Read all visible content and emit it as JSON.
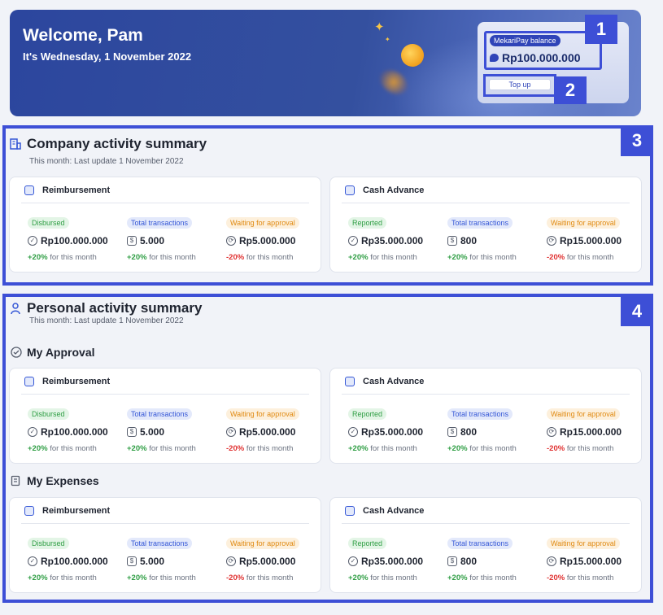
{
  "header": {
    "welcome": "Welcome, Pam",
    "date": "It's Wednesday, 1 November 2022",
    "balance_label": "MekariPay balance",
    "balance_amount": "Rp100.000.000",
    "topup_label": "Top up"
  },
  "badges": [
    "1",
    "2",
    "3",
    "4"
  ],
  "company": {
    "title": "Company activity summary",
    "subtitle": "This month: Last update 1 November 2022",
    "cards": [
      {
        "title": "Reimbursement",
        "stats": [
          {
            "label": "Disbursed",
            "value": "Rp100.000.000",
            "delta": "+20%",
            "delta_text": "for this month"
          },
          {
            "label": "Total transactions",
            "value": "5.000",
            "delta": "+20%",
            "delta_text": "for this month"
          },
          {
            "label": "Waiting for approval",
            "value": "Rp5.000.000",
            "delta": "-20%",
            "delta_text": "for this month"
          }
        ]
      },
      {
        "title": "Cash Advance",
        "stats": [
          {
            "label": "Reported",
            "value": "Rp35.000.000",
            "delta": "+20%",
            "delta_text": "for this month"
          },
          {
            "label": "Total transactions",
            "value": "800",
            "delta": "+20%",
            "delta_text": "for this month"
          },
          {
            "label": "Waiting for approval",
            "value": "Rp15.000.000",
            "delta": "-20%",
            "delta_text": "for this month"
          }
        ]
      }
    ]
  },
  "personal": {
    "title": "Personal activity summary",
    "subtitle": "This month: Last update 1 November 2022",
    "groups": [
      {
        "title": "My Approval",
        "cards": [
          {
            "title": "Reimbursement",
            "stats": [
              {
                "label": "Disbursed",
                "value": "Rp100.000.000",
                "delta": "+20%",
                "delta_text": "for this month"
              },
              {
                "label": "Total transactions",
                "value": "5.000",
                "delta": "+20%",
                "delta_text": "for this month"
              },
              {
                "label": "Waiting for approval",
                "value": "Rp5.000.000",
                "delta": "-20%",
                "delta_text": "for this month"
              }
            ]
          },
          {
            "title": "Cash Advance",
            "stats": [
              {
                "label": "Reported",
                "value": "Rp35.000.000",
                "delta": "+20%",
                "delta_text": "for this month"
              },
              {
                "label": "Total transactions",
                "value": "800",
                "delta": "+20%",
                "delta_text": "for this month"
              },
              {
                "label": "Waiting for approval",
                "value": "Rp15.000.000",
                "delta": "-20%",
                "delta_text": "for this month"
              }
            ]
          }
        ]
      },
      {
        "title": "My Expenses",
        "cards": [
          {
            "title": "Reimbursement",
            "stats": [
              {
                "label": "Disbursed",
                "value": "Rp100.000.000",
                "delta": "+20%",
                "delta_text": "for this month"
              },
              {
                "label": "Total transactions",
                "value": "5.000",
                "delta": "+20%",
                "delta_text": "for this month"
              },
              {
                "label": "Waiting for approval",
                "value": "Rp5.000.000",
                "delta": "-20%",
                "delta_text": "for this month"
              }
            ]
          },
          {
            "title": "Cash Advance",
            "stats": [
              {
                "label": "Reported",
                "value": "Rp35.000.000",
                "delta": "+20%",
                "delta_text": "for this month"
              },
              {
                "label": "Total transactions",
                "value": "800",
                "delta": "+20%",
                "delta_text": "for this month"
              },
              {
                "label": "Waiting for approval",
                "value": "Rp15.000.000",
                "delta": "-20%",
                "delta_text": "for this month"
              }
            ]
          }
        ]
      }
    ]
  },
  "colors": {
    "accent": "#3d4fd6",
    "banner": "#2c469e",
    "positive": "#2f9e44",
    "negative": "#e03131",
    "pending": "#e08a12"
  }
}
